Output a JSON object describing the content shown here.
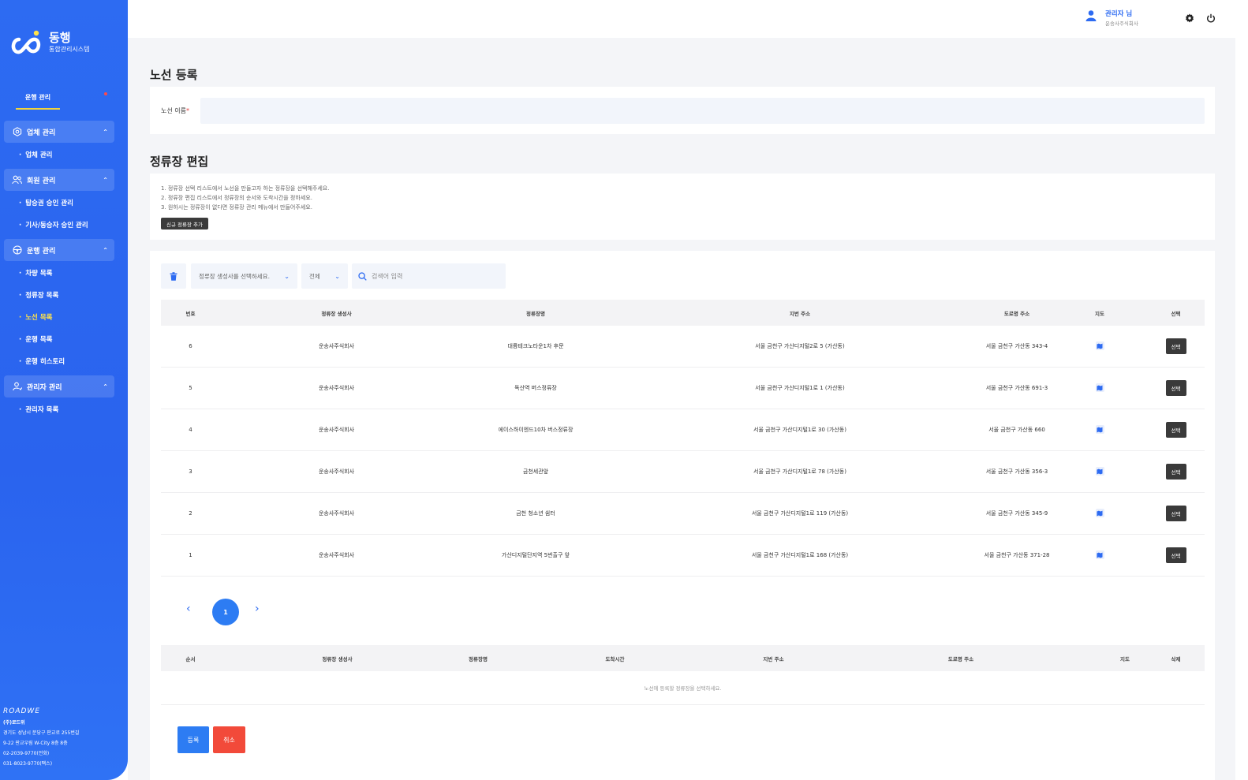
{
  "brand": {
    "title": "동행",
    "subtitle": "통합관리시스템"
  },
  "nav": {
    "top_tab": "운행 관리",
    "groups": [
      {
        "label": "업체 관리",
        "icon": "settings-hex-icon",
        "items": [
          "업체 관리"
        ]
      },
      {
        "label": "회원 관리",
        "icon": "users-icon",
        "items": [
          "탑승권 승인 관리",
          "기사/동승자 승인 관리"
        ]
      },
      {
        "label": "운행 관리",
        "icon": "steering-wheel-icon",
        "items": [
          "차량 목록",
          "정류장 목록",
          "노선 목록",
          "운행 목록",
          "운행 히스토리"
        ]
      },
      {
        "label": "관리자 관리",
        "icon": "admin-user-icon",
        "items": [
          "관리자 목록"
        ]
      }
    ],
    "active_item": "노선 목록"
  },
  "footer": {
    "brand": "ROADWE",
    "company": "(주)로드위",
    "address1": "경기도 성남시 분당구 판교로 255번길",
    "address2": "9-22 판교우림 W-City 8층 8층",
    "phone": "02-2039-9770(전화)",
    "fax": "031-8023-9770(팩스)"
  },
  "header": {
    "user_name": "관리자 님",
    "company": "운송사주식회사"
  },
  "route": {
    "title": "노선 등록",
    "name_label": "노선 이름",
    "name_value": ""
  },
  "stops": {
    "title": "정류장 편집",
    "instructions": [
      "1. 정류장 선택 리스트에서 노선을 만들고자 하는 정류장을 선택해주세요.",
      "2. 정류장 편집 리스트에서 정류장의 순서와 도착시간을 정하세요.",
      "3. 원하시는 정류장이 없다면 정류장 관리 메뉴에서 만들어주세요."
    ],
    "new_stop_button": "신규 정류장 추가",
    "filter_creator_placeholder": "정류장 생성사를 선택하세요.",
    "filter_all": "전체",
    "search_placeholder": "검색어 입력",
    "columns": [
      "번호",
      "정류장 생성사",
      "정류장명",
      "지번 주소",
      "도로명 주소",
      "지도",
      "선택"
    ],
    "rows": [
      {
        "no": "6",
        "creator": "운송사주식회사",
        "name": "대륭테크노타운1차 후문",
        "jibun": "서울 금천구 가산디지털2로 5 (가산동)",
        "road": "서울 금천구 가산동 343-4",
        "select": "선택"
      },
      {
        "no": "5",
        "creator": "운송사주식회사",
        "name": "독산역 버스정류장",
        "jibun": "서울 금천구 가산디지털1로 1 (가산동)",
        "road": "서울 금천구 가산동 691-3",
        "select": "선택"
      },
      {
        "no": "4",
        "creator": "운송사주식회사",
        "name": "에이스하이엔드10차 버스정류장",
        "jibun": "서울 금천구 가산디지털1로 30 (가산동)",
        "road": "서울 금천구 가산동 660",
        "select": "선택"
      },
      {
        "no": "3",
        "creator": "운송사주식회사",
        "name": "금천세관앞",
        "jibun": "서울 금천구 가산디지털1로 78 (가산동)",
        "road": "서울 금천구 가산동 356-3",
        "select": "선택"
      },
      {
        "no": "2",
        "creator": "운송사주식회사",
        "name": "금천 청소년 쉼터",
        "jibun": "서울 금천구 가산디지털1로 119 (가산동)",
        "road": "서울 금천구 가산동 345-9",
        "select": "선택"
      },
      {
        "no": "1",
        "creator": "운송사주식회사",
        "name": "가산디지털단지역 5번출구 앞",
        "jibun": "서울 금천구 가산디지털1로 168 (가산동)",
        "road": "서울 금천구 가산동 371-28",
        "select": "선택"
      }
    ],
    "current_page": "1",
    "edit_columns": [
      "순서",
      "정류장 생성사",
      "정류장명",
      "도착시간",
      "지번 주소",
      "도로명 주소",
      "지도",
      "삭제"
    ],
    "edit_empty": "노선에 등록할 정류장을 선택하세요."
  },
  "actions": {
    "register": "등록",
    "cancel": "취소"
  },
  "colors": {
    "primary": "#2d6bf2",
    "danger": "#f24a3a",
    "active_nav": "#ffe24a"
  }
}
